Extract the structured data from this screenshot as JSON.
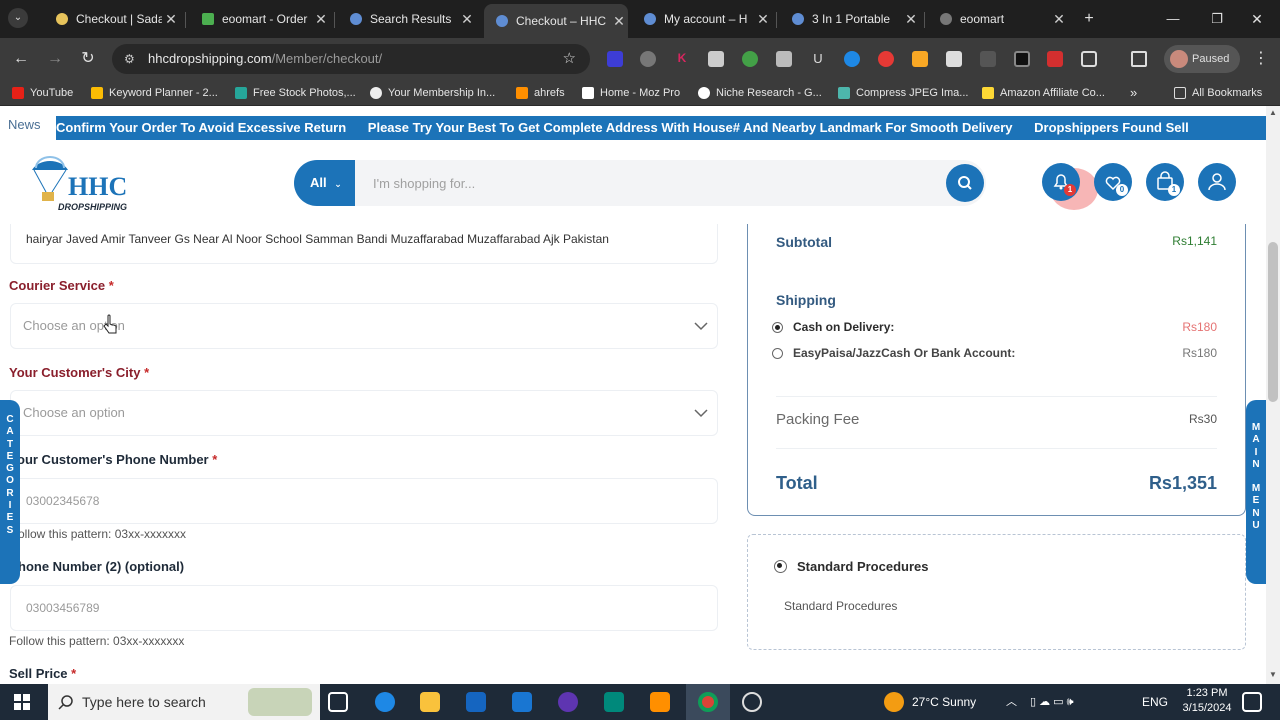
{
  "browser": {
    "tabs": [
      {
        "title": "Checkout | Sada",
        "active": false
      },
      {
        "title": "eoomart - Order",
        "active": false
      },
      {
        "title": "Search Results",
        "active": false
      },
      {
        "title": "Checkout – HHC",
        "active": true
      },
      {
        "title": "My account – H",
        "active": false
      },
      {
        "title": "3 In 1 Portable",
        "active": false
      },
      {
        "title": "eoomart",
        "active": false
      }
    ],
    "url_domain": "hhcdropshipping.com",
    "url_path": "/Member/checkout/",
    "profile_label": "Paused",
    "bookmarks": [
      "YouTube",
      "Keyword Planner - 2...",
      "Free Stock Photos,...",
      "Your Membership In...",
      "ahrefs",
      "Home - Moz Pro",
      "Niche Research - G...",
      "Compress JPEG Ima...",
      "Amazon Affiliate Co..."
    ],
    "all_bookmarks": "All Bookmarks"
  },
  "ticker": {
    "label": "News",
    "messages": [
      "Confirm Your Order To Avoid Excessive Return",
      "Please Try Your Best To Get Complete Address With House# And Nearby Landmark For Smooth Delivery",
      "Dropshippers Found Sell"
    ]
  },
  "header": {
    "logo_main": "HHC",
    "logo_sub": "DROPSHIPPING",
    "search_category": "All",
    "search_placeholder": "I'm shopping for...",
    "notifications_count": "1",
    "wishlist_count": "0",
    "cart_count": "1"
  },
  "form": {
    "address_value": "hairyar Javed Amir Tanveer Gs Near Al Noor School Samman Bandi Muzaffarabad Muzaffarabad Ajk Pakistan",
    "courier_label": "Courier Service",
    "courier_placeholder": "Choose an option",
    "city_label": "Your Customer's City",
    "city_placeholder": "Choose an option",
    "phone_label": "our Customer's Phone Number",
    "phone_placeholder": "03002345678",
    "phone_hint": "ollow this pattern: 03xx-xxxxxxx",
    "phone2_label": "hone Number (2) (optional)",
    "phone2_placeholder": "03003456789",
    "phone2_hint": "Follow this pattern: 03xx-xxxxxxx",
    "sell_price_label": "Sell Price",
    "required_mark": "*"
  },
  "summary": {
    "subtotal_label": "Subtotal",
    "subtotal_value": "Rs1,141",
    "shipping_label": "Shipping",
    "shipping_options": [
      {
        "label": "Cash on Delivery:",
        "value": "Rs180",
        "selected": true
      },
      {
        "label": "EasyPaisa/JazzCash Or Bank Account:",
        "value": "Rs180",
        "selected": false
      }
    ],
    "packing_label": "Packing Fee",
    "packing_value": "Rs30",
    "total_label": "Total",
    "total_value": "Rs1,351"
  },
  "procedures": {
    "option_label": "Standard Procedures",
    "description": "Standard Procedures"
  },
  "side_tabs": {
    "left": [
      "C",
      "A",
      "T",
      "E",
      "G",
      "O",
      "R",
      "I",
      "E",
      "S"
    ],
    "right": [
      "M",
      "A",
      "I",
      "N",
      "M",
      "E",
      "N",
      "U"
    ]
  },
  "taskbar": {
    "search_placeholder": "Type here to search",
    "weather": "27°C  Sunny",
    "lang": "ENG",
    "time": "1:23 PM",
    "date": "3/15/2024"
  },
  "colors": {
    "brand_blue": "#1c73b8",
    "label_red": "#8a1f2c",
    "price_green": "#2e7d32"
  }
}
